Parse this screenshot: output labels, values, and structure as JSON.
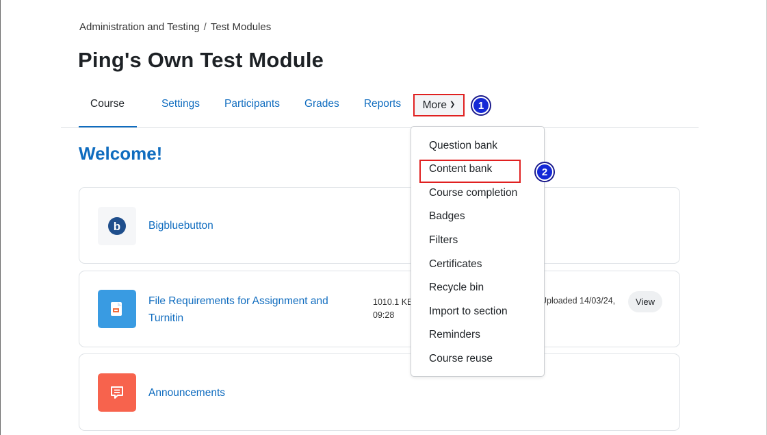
{
  "breadcrumb": {
    "items": [
      "Administration and Testing",
      "Test Modules"
    ],
    "separator": "/"
  },
  "page_title": "Ping's Own Test Module",
  "tabs": [
    {
      "label": "Course",
      "active": true
    },
    {
      "label": "Settings"
    },
    {
      "label": "Participants"
    },
    {
      "label": "Grades"
    },
    {
      "label": "Reports"
    }
  ],
  "more": {
    "label": "More",
    "icon": "chevron-down-icon"
  },
  "badges": {
    "one": "1",
    "two": "2"
  },
  "welcome": "Welcome!",
  "activities": [
    {
      "name": "Bigbluebutton",
      "icon": "bigbluebutton-icon",
      "glyph": "b"
    },
    {
      "name": "File Requirements for Assignment and Turnitin",
      "icon": "file-icon",
      "size": "1010.1 KB",
      "time": "09:28",
      "uploaded": "Uploaded 14/03/24,",
      "view_label": "View"
    },
    {
      "name": "Announcements",
      "icon": "forum-icon"
    }
  ],
  "dropdown": {
    "items": [
      "Question bank",
      "Content bank",
      "Course completion",
      "Badges",
      "Filters",
      "Certificates",
      "Recycle bin",
      "Import to section",
      "Reminders",
      "Course reuse"
    ]
  },
  "colors": {
    "link": "#0f6cbf",
    "highlight": "#e02020",
    "badge": "#1428d6",
    "file_icon_bg": "#399be2",
    "forum_icon_bg": "#f7634d"
  }
}
